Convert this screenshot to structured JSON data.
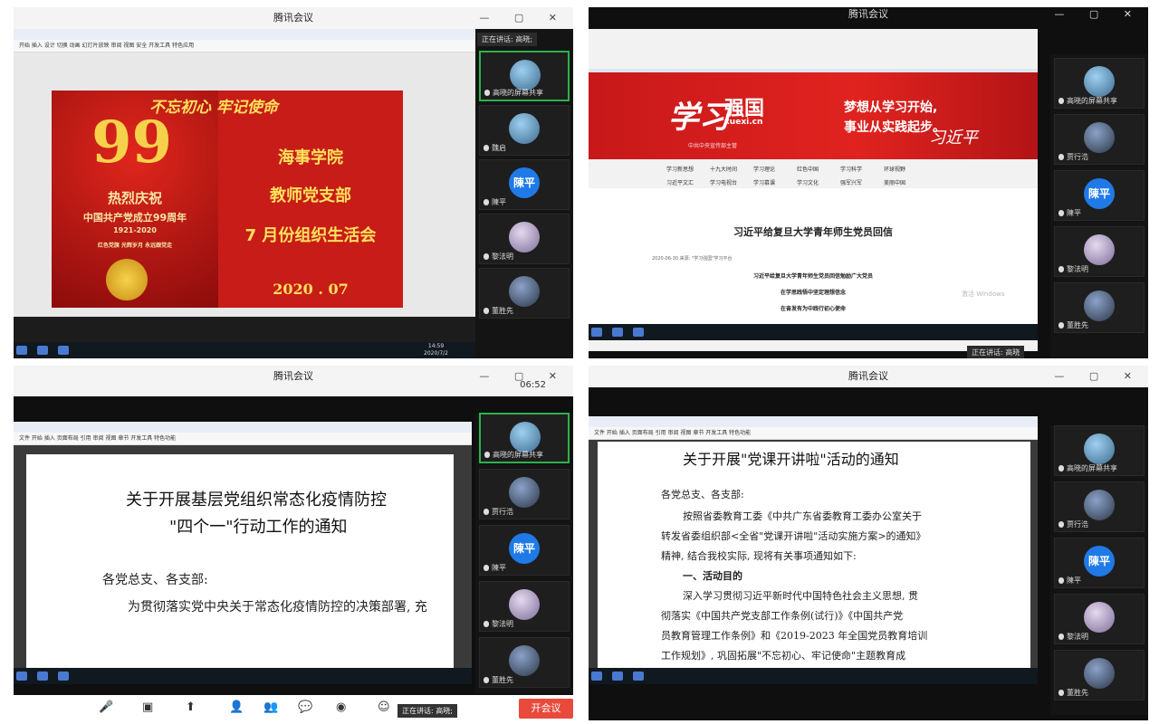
{
  "app_title": "腾讯会议",
  "participants": [
    "高晓的屏幕共享",
    "贾行浩",
    "陳平",
    "黎法明",
    "董胜先"
  ],
  "first_tile_name_q1": "魏启",
  "avatar_text": "陳平",
  "speaking": {
    "q1": "正在讲话: 高晓;",
    "q2": "正在讲话: 高晓",
    "q3": "正在讲话: 高晓;"
  },
  "q1": {
    "slogan": "不忘初心  牢记使命",
    "big_number": "99",
    "celebrate": "热烈庆祝",
    "founding": "中国共产党成立99周年",
    "years": "1921-2020",
    "motto": "红色党旗  光辉岁月  永远跟党走",
    "line1": "海事学院",
    "line2": "教师党支部",
    "line3": "7 月份组织生活会",
    "date": "2020 . 07",
    "time": "14:59",
    "date_small": "2020/7/2"
  },
  "q2": {
    "logo": "学习",
    "logo2": "强国",
    "url": "xuexi.cn",
    "sub": "中共中央宣传部主管",
    "tag1": "梦想从学习开始,",
    "tag2": "事业从实践起步。",
    "sign": "习近平",
    "nav_row1": [
      "学习新思想",
      "十九大时间",
      "学习理论",
      "红色中国",
      "学习科学",
      "环球视野"
    ],
    "nav_row2": [
      "习近平文汇",
      "学习电视台",
      "学习慕课",
      "学习文化",
      "强军兴军",
      "美丽中国"
    ],
    "article_title": "习近平给复旦大学青年师生党员回信",
    "article_meta": "2020-06-30  来源: \"学习强国\"学习平台",
    "article_l1": "习近平给复旦大学青年师生党员回信勉励广大党员",
    "article_l2": "在学思践悟中坚定理想信念",
    "article_l3": "在奋发有为中践行初心使命",
    "watermark": "激活 Windows"
  },
  "q3": {
    "timer": "06:52",
    "title1": "关于开展基层党组织常态化疫情防控",
    "title2": "\"四个一\"行动工作的通知",
    "salutation": "各党总支、各支部:",
    "body": "为贯彻落实党中央关于常态化疫情防控的决策部署, 充"
  },
  "q4": {
    "title": "关于开展\"党课开讲啦\"活动的通知",
    "salutation": "各党总支、各支部:",
    "p1a": "按照省委教育工委《中共广东省委教育工委办公室关于",
    "p1b": "转发省委组织部<全省\"党课开讲啦\"活动实施方案>的通知》",
    "p1c": "精神, 结合我校实际, 现将有关事项通知如下:",
    "h1": "一、活动目的",
    "p2a": "深入学习贯彻习近平新时代中国特色社会主义思想, 贯",
    "p2b": "彻落实《中国共产党支部工作条例(试行)》《中国共产党",
    "p2c": "员教育管理工作条例》和《2019-2023 年全国党员教育培训",
    "p2d": "工作规划》, 巩固拓展\"不忘初心、牢记使命\"主题教育成"
  },
  "bottom": {
    "leave": "开会议"
  }
}
